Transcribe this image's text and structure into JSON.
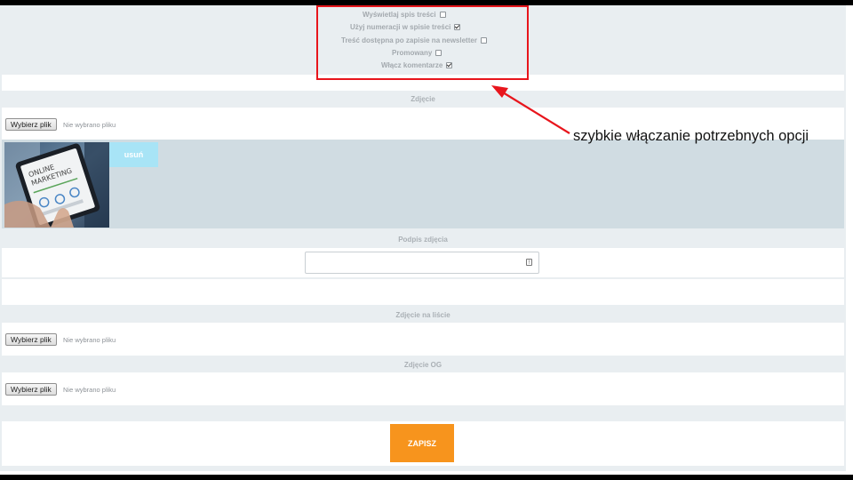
{
  "options": {
    "items": [
      {
        "label": "Wyświetlaj spis treści",
        "checked": false
      },
      {
        "label": "Użyj numeracji w spisie treści",
        "checked": true
      },
      {
        "label": "Treść dostępna po zapisie na newsletter",
        "checked": false
      },
      {
        "label": "Promowany",
        "checked": false
      },
      {
        "label": "Włącz komentarze",
        "checked": true
      }
    ]
  },
  "photo": {
    "section_label": "Zdjęcie",
    "file_button": "Wybierz plik",
    "no_file": "Nie wybrano pliku",
    "remove_button": "usuń",
    "thumbnail_text": [
      "ONLINE",
      "MARKETING"
    ]
  },
  "caption": {
    "label": "Podpis zdjęcia",
    "value": "",
    "icon": "info-icon"
  },
  "list_photo": {
    "label": "Zdjęcie na liście",
    "file_button": "Wybierz plik",
    "no_file": "Nie wybrano pliku"
  },
  "og_photo": {
    "label": "Zdjęcie OG",
    "file_button": "Wybierz plik",
    "no_file": "Nie wybrano pliku"
  },
  "save_button": "ZAPISZ",
  "annotation": {
    "text": "szybkie włączanie potrzebnych opcji"
  },
  "colors": {
    "highlight_red": "#e8151c",
    "save_orange": "#f7941d",
    "remove_cyan": "#a8e4f6"
  }
}
